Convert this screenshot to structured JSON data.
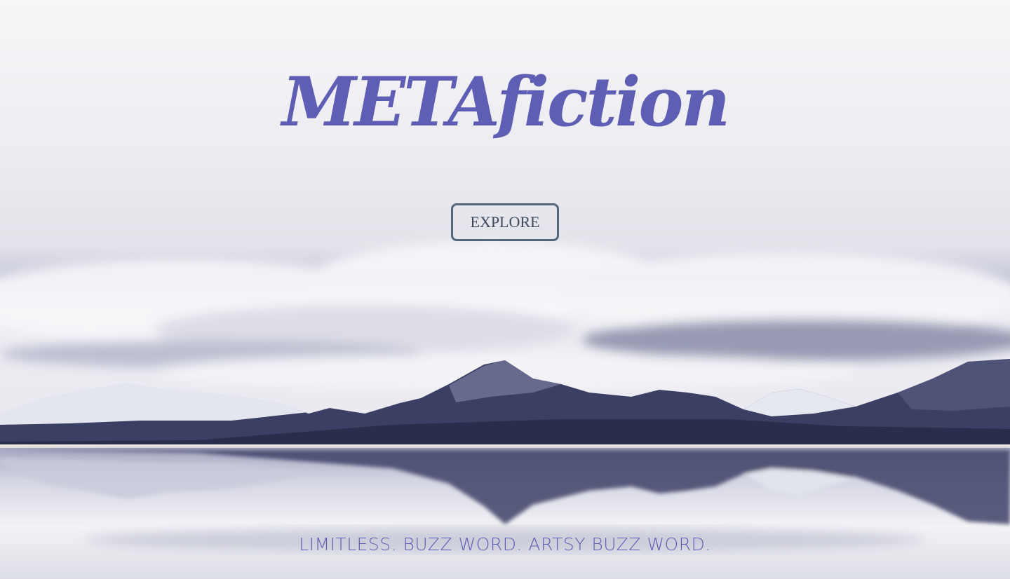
{
  "hero": {
    "title": "METAfiction",
    "explore_label": "EXPLORE",
    "tagline": "LIMITLESS. BUZZ WORD. ARTSY BUZZ WORD."
  },
  "colors": {
    "accent": "#5e5fb4",
    "button_border": "#56667a",
    "button_text": "#3e4a5c",
    "mountain_dark": "#34385a",
    "snow": "#eef0f5"
  }
}
